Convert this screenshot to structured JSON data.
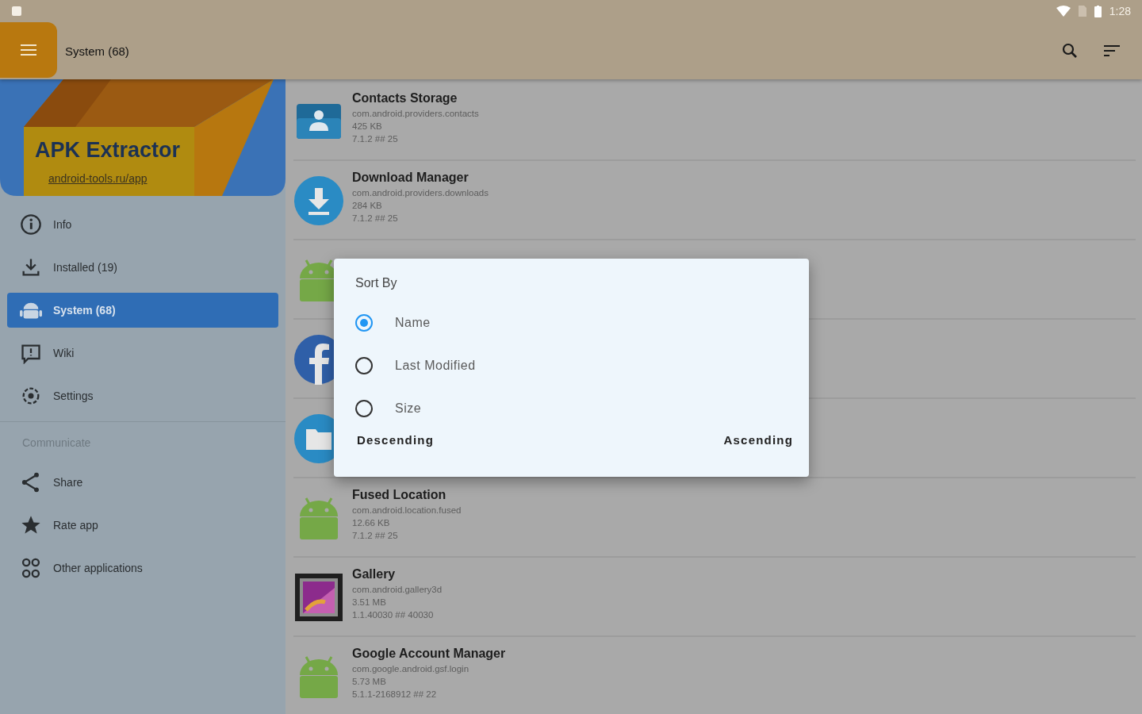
{
  "status_bar": {
    "time": "1:28"
  },
  "app_bar": {
    "title": "System (68)"
  },
  "drawer": {
    "header": {
      "title": "APK Extractor",
      "link": "android-tools.ru/app"
    },
    "items": [
      {
        "kind": "info",
        "label": "Info",
        "selected": false
      },
      {
        "kind": "download",
        "label": "Installed (19)",
        "selected": false
      },
      {
        "kind": "android",
        "label": "System (68)",
        "selected": true
      },
      {
        "kind": "wiki",
        "label": "Wiki",
        "selected": false
      },
      {
        "kind": "settings",
        "label": "Settings",
        "selected": false
      }
    ],
    "section_title": "Communicate",
    "section_items": [
      {
        "kind": "share",
        "label": "Share"
      },
      {
        "kind": "star",
        "label": "Rate app"
      },
      {
        "kind": "apps",
        "label": "Other applications"
      }
    ]
  },
  "apps": [
    {
      "kind": "contacts",
      "name": "Contacts Storage",
      "package": "com.android.providers.contacts",
      "size": "425 KB",
      "version": "7.1.2 ## 25"
    },
    {
      "kind": "download",
      "name": "Download Manager",
      "package": "com.android.providers.downloads",
      "size": "284 KB",
      "version": "7.1.2 ## 25"
    },
    {
      "kind": "android"
    },
    {
      "kind": "facebook"
    },
    {
      "kind": "folder"
    },
    {
      "kind": "android",
      "name": "Fused Location",
      "package": "com.android.location.fused",
      "size": "12.66 KB",
      "version": "7.1.2 ## 25"
    },
    {
      "kind": "gallery",
      "name": "Gallery",
      "package": "com.android.gallery3d",
      "size": "3.51 MB",
      "version": "1.1.40030 ## 40030"
    },
    {
      "kind": "android",
      "name": "Google Account Manager",
      "package": "com.google.android.gsf.login",
      "size": "5.73 MB",
      "version": "5.1.1-2168912 ## 22"
    }
  ],
  "sort_dialog": {
    "title": "Sort By",
    "options": [
      {
        "label": "Name",
        "selected": true
      },
      {
        "label": "Last Modified",
        "selected": false
      },
      {
        "label": "Size",
        "selected": false
      }
    ],
    "buttons": [
      "Descending",
      "Ascending"
    ]
  }
}
